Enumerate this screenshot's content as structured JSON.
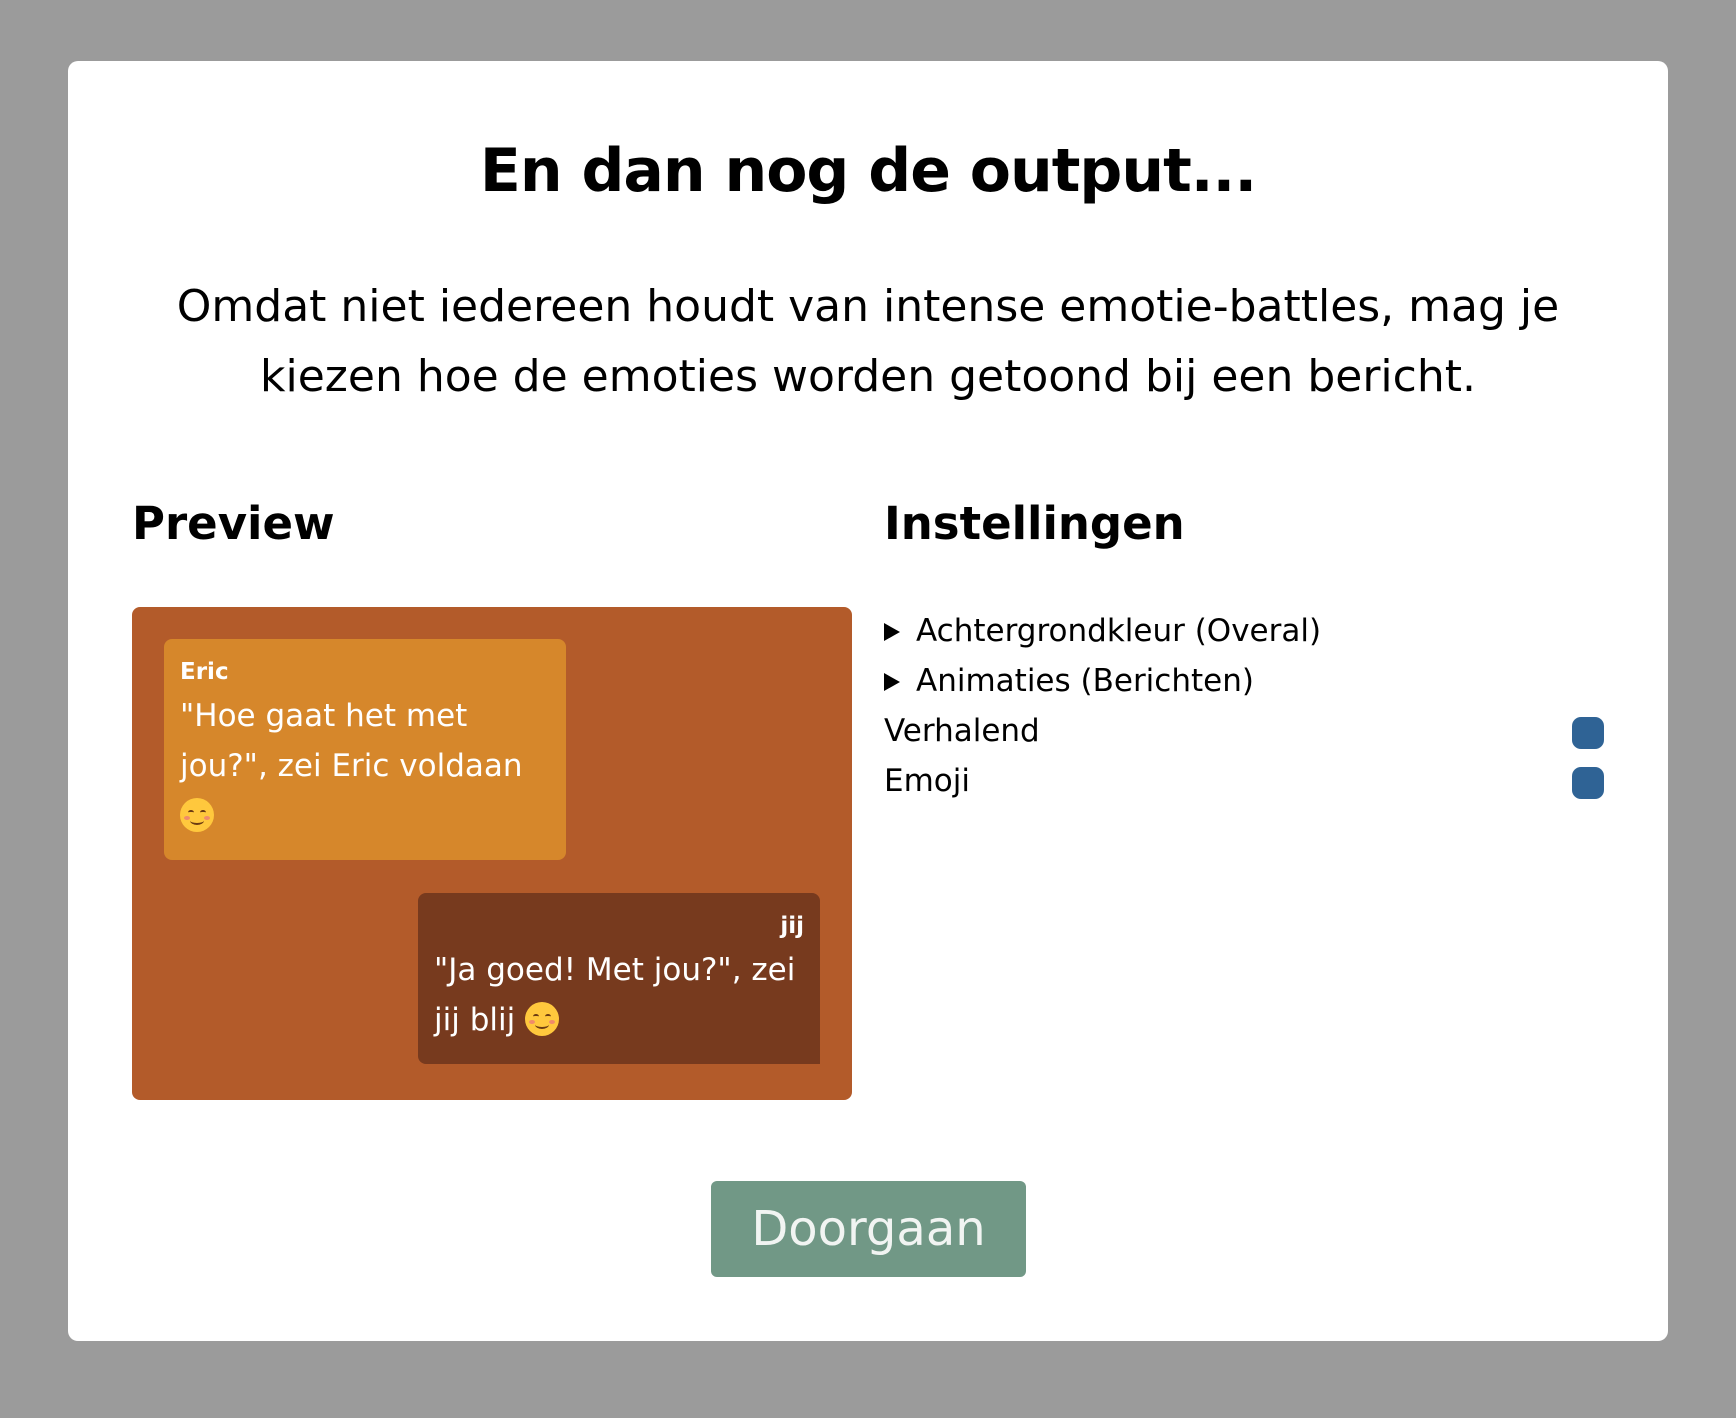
{
  "modal": {
    "title": "En dan nog de output...",
    "intro": "Omdat niet iedereen houdt van intense emotie-battles, mag je kiezen hoe de emoties worden getoond bij een bericht."
  },
  "preview": {
    "heading": "Preview",
    "background_color": "#b35b2a",
    "messages": [
      {
        "sender": "Eric",
        "text": "\"Hoe gaat het met jou?\", zei Eric voldaan",
        "emoji": "relieved-face-emoji",
        "bubble_color": "#d6872b"
      },
      {
        "sender": "jij",
        "text": "\"Ja goed! Met jou?\", zei jij blij",
        "emoji": "smiling-face-emoji",
        "bubble_color": "#773a1e"
      }
    ]
  },
  "settings": {
    "heading": "Instellingen",
    "items": [
      {
        "label": "Achtergrondkleur (Overal)",
        "type": "disclosure",
        "icon": "triangle-right-icon"
      },
      {
        "label": "Animaties (Berichten)",
        "type": "disclosure",
        "icon": "triangle-right-icon"
      },
      {
        "label": "Verhalend",
        "type": "toggle",
        "toggle_color": "#2f6395"
      },
      {
        "label": "Emoji",
        "type": "toggle",
        "toggle_color": "#2f6395"
      }
    ]
  },
  "actions": {
    "continue_label": "Doorgaan",
    "continue_color": "#719886"
  }
}
